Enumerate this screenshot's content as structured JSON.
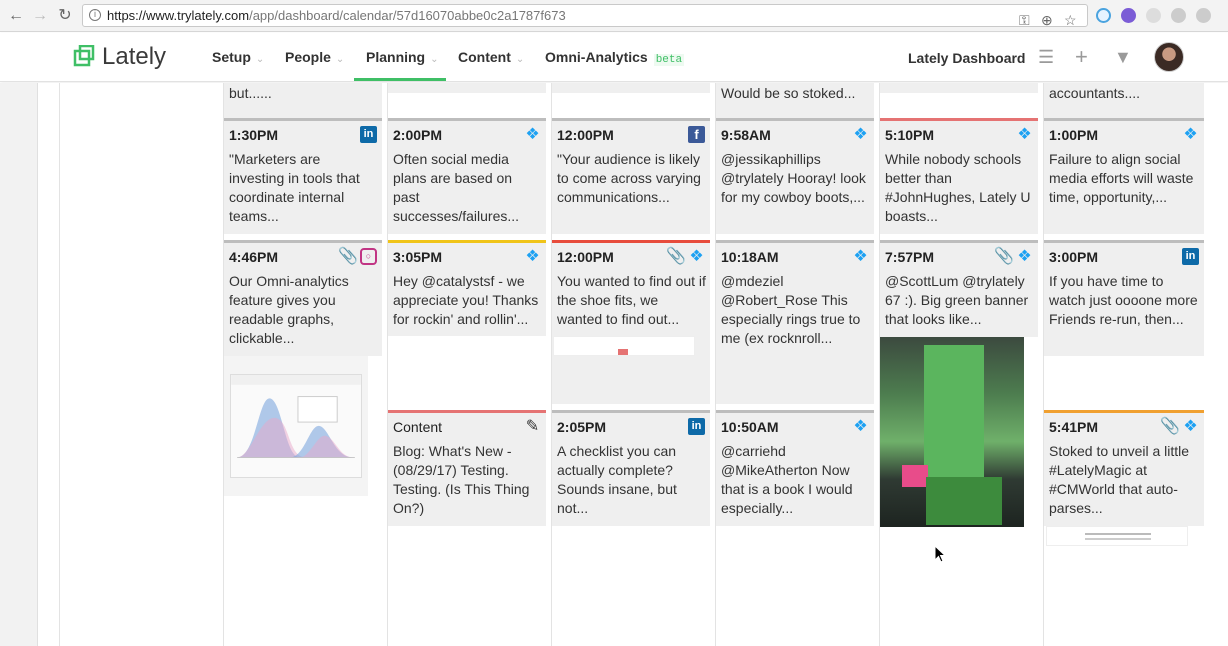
{
  "browser": {
    "url_host": "https://www.trylately.com",
    "url_path": "/app/dashboard/calendar/57d16070abbe0c2a1787f673",
    "back_icon": "arrow-left-icon",
    "forward_icon": "arrow-right-icon",
    "reload_icon": "reload-icon"
  },
  "header": {
    "logo": "Lately",
    "menu": [
      {
        "label": "Setup"
      },
      {
        "label": "People"
      },
      {
        "label": "Planning"
      },
      {
        "label": "Content"
      },
      {
        "label": "Omni-Analytics"
      }
    ],
    "beta_label": "beta",
    "active_menu": "Planning",
    "dashboard_label": "Lately Dashboard",
    "accent": "#3fbf66"
  },
  "top_strip": {
    "col1": "but......",
    "col4": "Would be so stoked...",
    "col6": "accountants...."
  },
  "cards": [
    {
      "time": "1:30PM",
      "body": "\"Marketers are investing in tools that coordinate internal teams...",
      "icons": [
        "linkedin-icon"
      ]
    },
    {
      "time": "2:00PM",
      "body": "Often social media plans are based on past successes/failures...",
      "icons": [
        "twitter-icon"
      ]
    },
    {
      "time": "12:00PM",
      "body": "\"Your audience is likely to come across varying communications...",
      "icons": [
        "facebook-icon"
      ]
    },
    {
      "time": "9:58AM",
      "body": "@jessikaphillips @trylately Hooray! look for my cowboy boots,...",
      "icons": [
        "twitter-icon"
      ]
    },
    {
      "time": "5:10PM",
      "body": "While nobody schools better than #JohnHughes, Lately U boasts...",
      "icons": [
        "twitter-icon"
      ]
    },
    {
      "time": "1:00PM",
      "body": "Failure to align social media efforts will waste time, opportunity,...",
      "icons": [
        "twitter-icon"
      ]
    },
    {
      "time": "4:46PM",
      "body": "Our Omni-analytics feature gives you readable graphs, clickable...",
      "icons": [
        "paperclip-icon",
        "instagram-icon"
      ]
    },
    {
      "time": "3:05PM",
      "body": "Hey @catalystsf - we appreciate you! Thanks for rockin' and rollin'...",
      "icons": [
        "twitter-icon"
      ]
    },
    {
      "time": "12:00PM",
      "body": "You wanted to find out if the shoe fits, we wanted to find out...",
      "icons": [
        "paperclip-icon",
        "twitter-icon"
      ]
    },
    {
      "time": "10:18AM",
      "body": "@mdeziel @Robert_Rose This especially rings true to me (ex rocknroll...",
      "icons": [
        "twitter-icon"
      ]
    },
    {
      "time": "7:57PM",
      "body": "@ScottLum @trylately 67 :). Big green banner that looks like...",
      "icons": [
        "paperclip-icon",
        "twitter-icon"
      ]
    },
    {
      "time": "3:00PM",
      "body": "If you have time to watch just oooone more Friends re-run, then...",
      "icons": [
        "linkedin-icon"
      ]
    },
    {
      "time": "Content",
      "body": "Blog: What's New - (08/29/17) Testing. Testing. (Is This Thing On?)",
      "icons": [
        "pencil-icon"
      ]
    },
    {
      "time": "2:05PM",
      "body": "A checklist you can actually complete? Sounds insane, but not...",
      "icons": [
        "linkedin-icon"
      ]
    },
    {
      "time": "10:50AM",
      "body": "@carriehd @MikeAtherton Now that is a book I would especially...",
      "icons": [
        "twitter-icon"
      ]
    },
    {
      "time": "5:41PM",
      "body": "Stoked to unveil a little #LatelyMagic at #CMWorld that auto-parses...",
      "icons": [
        "paperclip-icon",
        "twitter-icon"
      ]
    }
  ],
  "colors": {
    "twitter": "#1da1f2",
    "linkedin": "#0e6aa8",
    "facebook": "#3b5998",
    "instagram": "#c13584",
    "bar_grey": "#bdbdbd",
    "bar_yellow": "#f0c419",
    "bar_red": "#e57373",
    "bar_orange": "#f0a030"
  }
}
